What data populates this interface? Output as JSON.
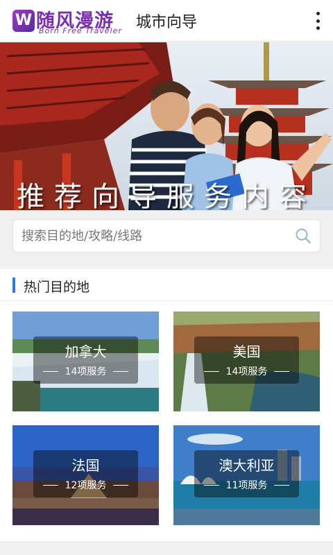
{
  "header": {
    "logo_badge": "W",
    "logo_cn": "随风漫游",
    "logo_en": "Born Free Traveler",
    "title": "城市向导",
    "more_icon": "more-vertical-icon"
  },
  "banner": {
    "text": "推荐向导服务内容"
  },
  "search": {
    "placeholder": "搜索目的地/攻略/线路",
    "icon": "search-icon"
  },
  "hot": {
    "title": "热门目的地",
    "accent": "#2f7de1",
    "destinations": [
      {
        "name": "加拿大",
        "count": "14项服务"
      },
      {
        "name": "美国",
        "count": "14项服务"
      },
      {
        "name": "法国",
        "count": "12项服务"
      },
      {
        "name": "澳大利亚",
        "count": "11项服务"
      }
    ]
  }
}
